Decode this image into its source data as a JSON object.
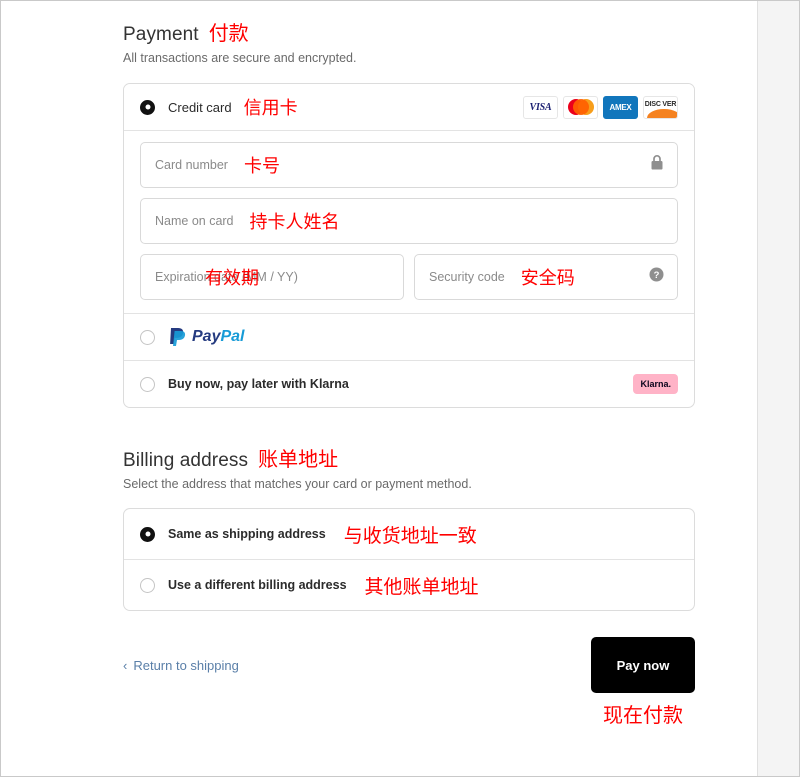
{
  "payment": {
    "title": "Payment",
    "title_cn": "付款",
    "subtitle": "All transactions are secure and encrypted.",
    "methods": [
      {
        "id": "credit-card",
        "label": "Credit card",
        "label_cn": "信用卡",
        "selected": true,
        "brands": [
          "VISA",
          "Mastercard",
          "AMEX",
          "DISCOVER"
        ]
      },
      {
        "id": "paypal",
        "label": "PayPal",
        "label_cn": "",
        "selected": false
      },
      {
        "id": "klarna",
        "label": "Buy now, pay later with Klarna",
        "label_cn": "",
        "selected": false,
        "badge": "Klarna."
      }
    ],
    "fields": {
      "card_number": {
        "placeholder": "Card number",
        "value": "",
        "cn": "卡号",
        "icon": "lock-icon"
      },
      "name_on_card": {
        "placeholder": "Name on card",
        "value": "",
        "cn": "持卡人姓名"
      },
      "expiration": {
        "placeholder": "Expiration date (MM / YY)",
        "value": "",
        "cn": "有效期"
      },
      "security_code": {
        "placeholder": "Security code",
        "value": "",
        "cn": "安全码",
        "icon": "help-icon"
      }
    }
  },
  "billing": {
    "title": "Billing address",
    "title_cn": "账单地址",
    "subtitle": "Select the address that matches your card or payment method.",
    "options": [
      {
        "id": "same-as-shipping",
        "label": "Same as shipping address",
        "label_cn": "与收货地址一致",
        "selected": true
      },
      {
        "id": "different-billing",
        "label": "Use a different billing address",
        "label_cn": "其他账单地址",
        "selected": false
      }
    ]
  },
  "footer": {
    "back_label": "Return to shipping",
    "back_chevron": "‹",
    "pay_label": "Pay now",
    "pay_label_cn": "现在付款"
  },
  "brand_logos": {
    "visa": "VISA",
    "amex": "AMEX",
    "discover": "DISC VER",
    "paypal_pay": "Pay",
    "paypal_pal": "Pal"
  },
  "colors": {
    "accent_red": "#ff0000",
    "visa_navy": "#1a1f71",
    "amex_blue": "#1176bc",
    "discover_orange": "#f58220",
    "klarna_pink": "#ffb3c7",
    "paypal_dark": "#253b80",
    "paypal_light": "#179bd7",
    "pay_button": "#000000"
  }
}
